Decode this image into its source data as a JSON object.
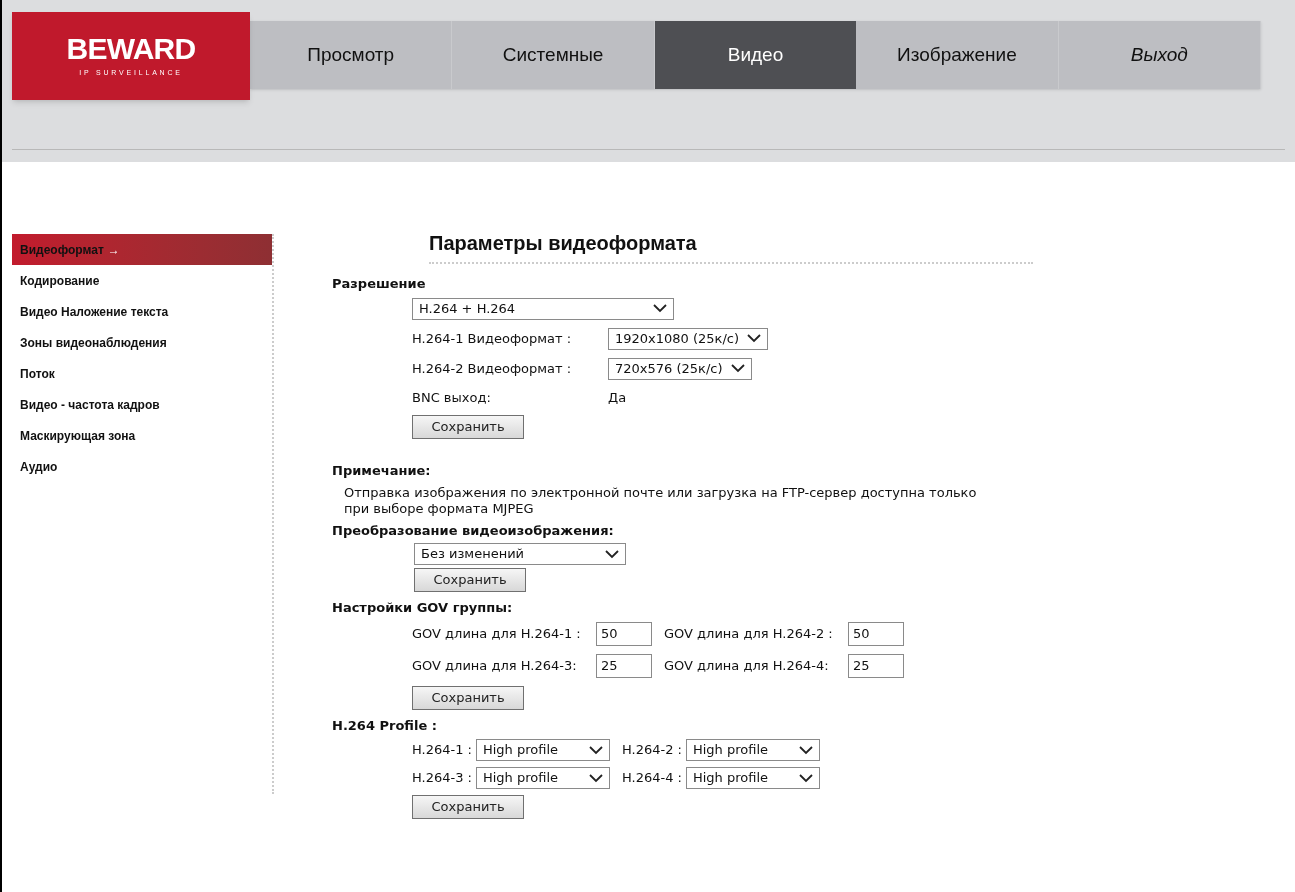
{
  "logo": {
    "brand": "BEWARD",
    "tagline": "IP SURVEILLANCE"
  },
  "nav": [
    {
      "label": "Просмотр",
      "selected": false,
      "italic": false
    },
    {
      "label": "Системные",
      "selected": false,
      "italic": false
    },
    {
      "label": "Видео",
      "selected": true,
      "italic": false
    },
    {
      "label": "Изображение",
      "selected": false,
      "italic": false
    },
    {
      "label": "Выход",
      "selected": false,
      "italic": true
    }
  ],
  "sidebar": {
    "items": [
      {
        "label": "Видеоформат",
        "selected": true,
        "arrow": "→"
      },
      {
        "label": "Кодирование",
        "selected": false
      },
      {
        "label": "Видео Наложение текста",
        "selected": false
      },
      {
        "label": "Зоны видеонаблюдения",
        "selected": false
      },
      {
        "label": "Поток",
        "selected": false
      },
      {
        "label": "Видео - частота кадров",
        "selected": false
      },
      {
        "label": "Маскирующая зона",
        "selected": false
      },
      {
        "label": "Аудио",
        "selected": false
      }
    ]
  },
  "title": "Параметры видеоформата",
  "resolution": {
    "heading": "Разрешение",
    "mode": "H.264 + H.264",
    "rows": [
      {
        "kind": "select",
        "label": "H.264-1 Видеоформат :",
        "value": "1920x1080 (25к/с)"
      },
      {
        "kind": "select",
        "label": "H.264-2 Видеоформат :",
        "value": "720x576 (25к/с)"
      },
      {
        "kind": "text",
        "label": "BNC выход:",
        "value": "Да"
      }
    ],
    "save": "Сохранить"
  },
  "note": {
    "heading": "Примечание:",
    "text": "Отправка изображения по электронной почте или загрузка на FTP-сервер доступна только при выборе формата MJPEG"
  },
  "transform": {
    "heading": "Преобразование видеоизображения:",
    "value": "Без изменений",
    "save": "Сохранить"
  },
  "gov": {
    "heading": "Настройки GOV группы:",
    "fields": [
      {
        "label": "GOV длина для H.264-1 :",
        "value": "50"
      },
      {
        "label": "GOV длина для H.264-2 :",
        "value": "50"
      },
      {
        "label": "GOV длина для H.264-3:",
        "value": "25"
      },
      {
        "label": "GOV длина для H.264-4:",
        "value": "25"
      }
    ],
    "save": "Сохранить"
  },
  "profile": {
    "heading": "H.264 Profile :",
    "fields": [
      {
        "label": "H.264-1 :",
        "value": "High profile"
      },
      {
        "label": "H.264-2 :",
        "value": "High profile"
      },
      {
        "label": "H.264-3 :",
        "value": "High profile"
      },
      {
        "label": "H.264-4 :",
        "value": "High profile"
      }
    ],
    "save": "Сохранить"
  }
}
